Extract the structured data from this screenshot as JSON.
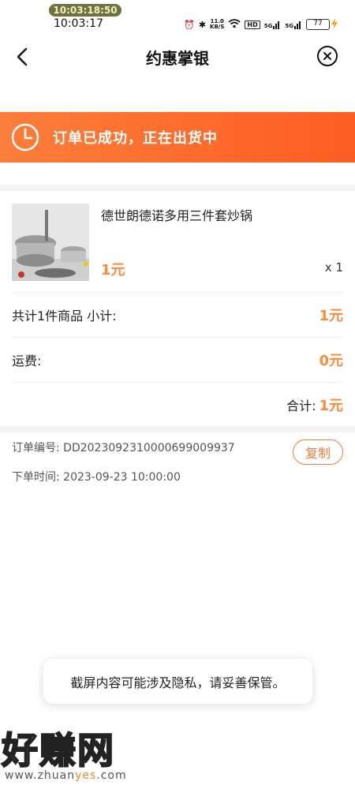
{
  "status_bar": {
    "recording_clock": "10:03:18:50",
    "time": "10:03:17",
    "net_speed_value": "11.0",
    "net_speed_unit": "KB/S",
    "hd_label": "HD",
    "sim1": "5G",
    "sim2": "5G",
    "battery": "77"
  },
  "nav": {
    "title": "约惠掌银"
  },
  "banner": {
    "text": "订单已成功，正在出货中",
    "color_start": "#fb7e3a",
    "color_end": "#fe5d22"
  },
  "product": {
    "name": "德世朗德诺多用三件套炒锅",
    "price": "1元",
    "quantity": "x 1"
  },
  "summary": {
    "subtotal_label": "共计1件商品 小计:",
    "subtotal_value": "1元",
    "shipping_label": "运费:",
    "shipping_value": "0元",
    "total_label": "合计:",
    "total_value": "1元"
  },
  "order": {
    "number_label": "订单编号:",
    "number_value": "DD2023092310000699009937",
    "time_label": "下单时间:",
    "time_value": "2023-09-23 10:00:00",
    "copy_label": "复制"
  },
  "toast": {
    "text": "截屏内容可能涉及隐私，请妥善保管。"
  },
  "watermark": {
    "brand": "好赚网",
    "url_prefix": "www.zhuan",
    "url_highlight": "yes",
    "url_suffix": ".com"
  },
  "colors": {
    "accent": "#fb8a3c",
    "copy_border": "#f07a45"
  }
}
